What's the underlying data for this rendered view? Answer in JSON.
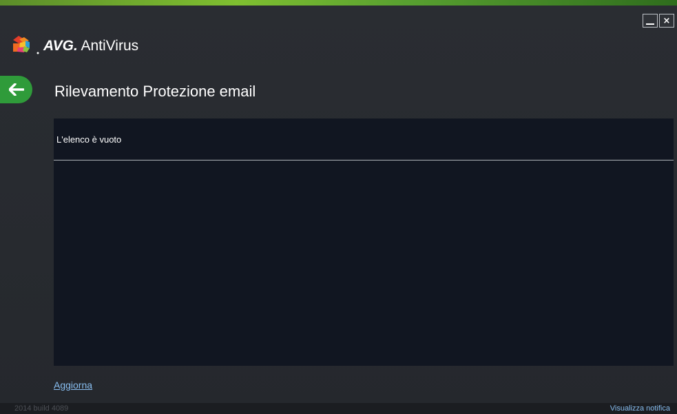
{
  "app": {
    "brand": "AVG.",
    "product": "AntiVirus"
  },
  "window": {
    "minimize_label": "—",
    "close_label": "×"
  },
  "navigation": {
    "back_icon": "arrow-left-icon"
  },
  "page": {
    "title": "Rilevamento Protezione email"
  },
  "detections": {
    "empty_message": "L'elenco è vuoto"
  },
  "actions": {
    "refresh_label": "Aggiorna"
  },
  "footer": {
    "build": "2014  build 4089",
    "notification_link": "Visualizza notifica"
  },
  "colors": {
    "accent_green": "#2f9b3a",
    "link_blue": "#89bff2",
    "panel": "#111621",
    "background": "#25282d"
  }
}
